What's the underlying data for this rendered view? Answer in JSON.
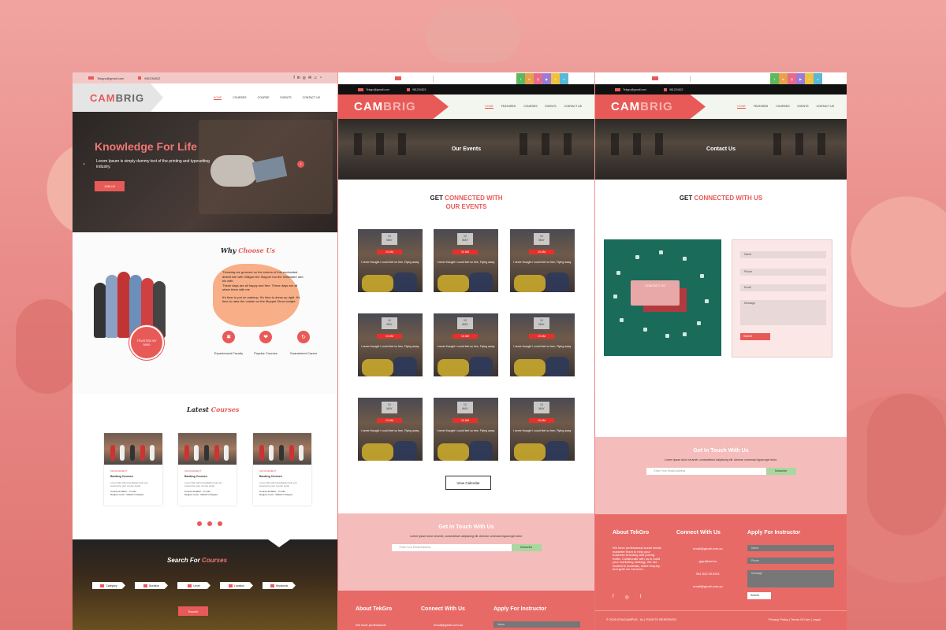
{
  "brand": {
    "logo_a": "CAM",
    "logo_b": "BRIG"
  },
  "p1": {
    "email": "Tekgro@gmail.com",
    "phone": "981234522",
    "social": [
      "f",
      "in",
      "◎",
      "✉",
      "♫",
      "◔"
    ],
    "nav": [
      "HOME",
      "COURSES",
      "COURSE",
      "EVENTS",
      "CONTACT US"
    ],
    "hero": {
      "title": "Knowledge For Life",
      "sub": "Lorem Ipsum is simply dummy text of the printing and typesetting industry.",
      "btn": "JOIN US"
    },
    "why": {
      "title_a": "Why ",
      "title_b": "Choose Us",
      "text1": "Thursday we grooved on the shores of this enchanted desert isle with Gilligan the Skipper too the millionaire and his wife.",
      "text2": "These days are all happy and free. These days are all share them with me",
      "text3": "It's time to put on makeup. It's time to dress up right. It's time to raise the curtain on the Muppet Show tonight.",
      "badge_a": "TRUSTED BY",
      "badge_b": "5000",
      "feats": [
        "Experienced Faculty",
        "Popular Courses",
        "Guaranteed Career"
      ]
    },
    "latest": {
      "title_a": "Latest ",
      "title_b": "Courses",
      "cards": [
        {
          "cat": "MANAGEMENT",
          "name": "Banking Courses",
          "desc": "Lorem We will immediately help you customize your course study",
          "meta1": "Course duration : 3 mots",
          "meta2": "Degree Level : Master's Degree"
        },
        {
          "cat": "MANAGEMENT",
          "name": "Banking Courses",
          "desc": "Lorem We will immediately help you customize your course study",
          "meta1": "Course duration : 3 mots",
          "meta2": "Degree Level : Master's Degree"
        },
        {
          "cat": "MANAGEMENT",
          "name": "Banking Courses",
          "desc": "Lorem We will immediately help you customize your course study",
          "meta1": "Course duration : 3 mots",
          "meta2": "Degree Level : Master's Degree"
        }
      ]
    },
    "search": {
      "title_a": "Search For ",
      "title_b": "Courses",
      "chips": [
        "Category",
        "Duration",
        "Level",
        "Location",
        "Keywords"
      ],
      "btn": "Search"
    }
  },
  "p2": {
    "email": "Tekgro@gmail.com",
    "phone": "981234522",
    "nav": [
      "HOME",
      "FEATURES",
      "COURSES",
      "EVENTS",
      "CONTACT US"
    ],
    "banner": "Our Events",
    "h_a": "GET ",
    "h_b": "CONNECTED WITH",
    "h_c": "OUR EVENTS",
    "event": {
      "day": "12",
      "month": "MAY",
      "time": "10 AM",
      "quote": "I never thought I could feel so free, Flying away"
    },
    "viewcal": "View Calendar",
    "touch": {
      "title": "Get In Touch With Us",
      "text": "Lorem ipsum dolor sit amet, consectetuer adipiscing elit. Aenean commodo ligula eget dolor.",
      "placeholder": "Enter Your Email Address",
      "btn": "Subscribe"
    },
    "foot": {
      "c1": "About TekGro",
      "c2": "Connect With Us",
      "c3": "Apply For Instructor",
      "t1": "We have professional",
      "t2": "email@gmail.com.au",
      "t3": "Name"
    }
  },
  "p3": {
    "email": "Tekgro@gmail.com",
    "phone": "981234522",
    "nav": [
      "HOME",
      "FEATURES",
      "COURSES",
      "EVENTS",
      "CONTACT US"
    ],
    "banner": "Contact Us",
    "h_a": "GET ",
    "h_b": "CONNECTED WITH US",
    "img_label": "CONTACT US",
    "form": {
      "name": "Name",
      "phone": "Phone",
      "email": "Email",
      "message": "Message",
      "submit": "Submit"
    },
    "touch": {
      "title": "Get In Touch With Us",
      "text": "Lorem ipsum dolor sit amet, consectetuer adipiscing elit. Aenean commodo ligula eget dolor.",
      "placeholder": "Enter Your Email Address",
      "btn": "Subscribe"
    },
    "foot": {
      "c1": "About TekGro",
      "c2": "Connect With Us",
      "c3": "Apply For Instructor",
      "about": "We have professional social media marketer team to help your business branding and pricing traffic. Collaborate with us to build your marketing strategy. We are located in Australia, make enquiry, and grab our services.",
      "contacts": [
        "email@gmail.com.au",
        "grgo@aol.ac",
        "981 832 09 8321",
        "email@gmail.com.au"
      ],
      "apply": {
        "name": "Name",
        "phone": "Phone",
        "message": "Message",
        "submit": "Submit"
      },
      "social": [
        "f",
        "◎",
        "t"
      ],
      "copy": "© 2020 EDUCAMPUS . ALL RIGHTS RESERVED",
      "links": "Privacy Policy | Terms Of Use | Legal"
    }
  },
  "colors": {
    "accent": "#e85a57",
    "footer": "#e86a67",
    "touch": "#f4bcba",
    "subscribe": "#a8d8a0"
  }
}
